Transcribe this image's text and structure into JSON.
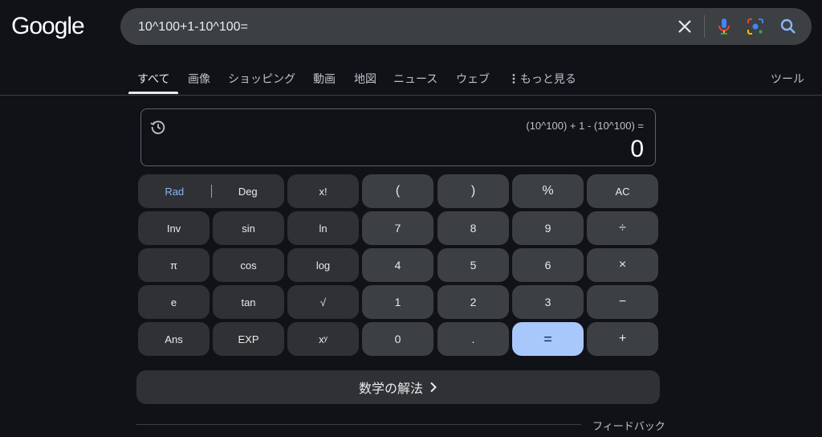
{
  "logo": "Google",
  "search": {
    "query": "10^100+1-10^100="
  },
  "tabs": [
    "すべて",
    "画像",
    "ショッピング",
    "動画",
    "地図",
    "ニュース",
    "ウェブ",
    "もっと見る"
  ],
  "tools_label": "ツール",
  "calculator": {
    "expression": "(10^100) + 1 - (10^100) =",
    "result": "0",
    "mode": {
      "rad": "Rad",
      "deg": "Deg"
    },
    "keys": {
      "fact": "x!",
      "lparen": "(",
      "rparen": ")",
      "percent": "%",
      "ac": "AC",
      "inv": "Inv",
      "sin": "sin",
      "ln": "ln",
      "k7": "7",
      "k8": "8",
      "k9": "9",
      "div": "÷",
      "pi": "π",
      "cos": "cos",
      "log": "log",
      "k4": "4",
      "k5": "5",
      "k6": "6",
      "mul": "×",
      "e": "e",
      "tan": "tan",
      "sqrt": "√",
      "k1": "1",
      "k2": "2",
      "k3": "3",
      "sub": "−",
      "ans": "Ans",
      "exp": "EXP",
      "pow": "xʸ",
      "k0": "0",
      "dot": ".",
      "eq": "=",
      "add": "+"
    }
  },
  "solve_label": "数学の解法",
  "feedback_label": "フィードバック",
  "colors": {
    "background": "#101218",
    "accent": "#a8c7fa",
    "key": "#3c4043"
  }
}
